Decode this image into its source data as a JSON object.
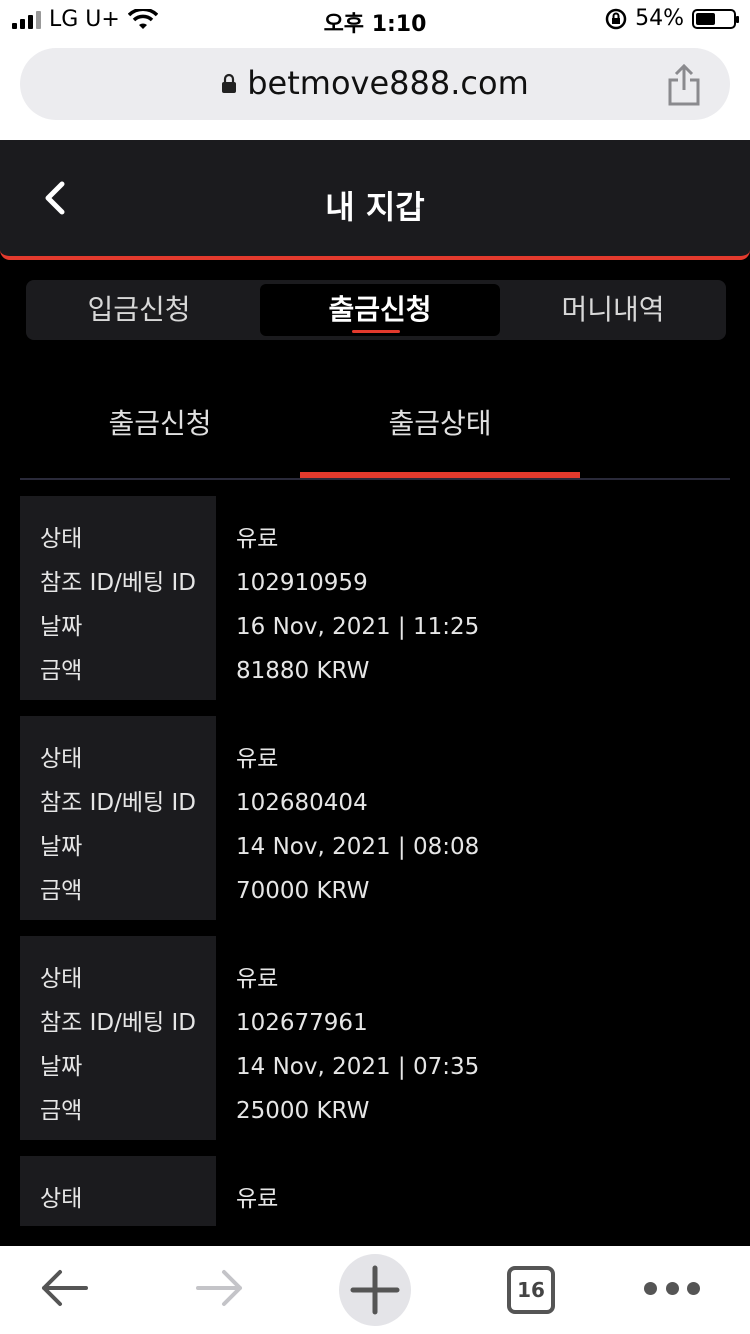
{
  "status_bar": {
    "carrier": "LG U+",
    "time": "오후 1:10",
    "battery": "54%",
    "battery_level": 0.54
  },
  "browser": {
    "url": "betmove888.com",
    "tabs_count": "16"
  },
  "header": {
    "title": "내 지갑"
  },
  "main_tabs": [
    {
      "label": "입금신청"
    },
    {
      "label": "출금신청"
    },
    {
      "label": "머니내역"
    }
  ],
  "sub_tabs": [
    {
      "label": "출금신청"
    },
    {
      "label": "출금상태"
    }
  ],
  "field_labels": {
    "status": "상태",
    "ref_id": "참조 ID/베팅 ID",
    "date": "날짜",
    "amount": "금액"
  },
  "records": [
    {
      "status": "유료",
      "ref_id": "102910959",
      "date": "16 Nov, 2021 | 11:25",
      "amount": "81880 KRW"
    },
    {
      "status": "유료",
      "ref_id": "102680404",
      "date": "14 Nov, 2021 | 08:08",
      "amount": "70000 KRW"
    },
    {
      "status": "유료",
      "ref_id": "102677961",
      "date": "14 Nov, 2021 | 07:35",
      "amount": "25000 KRW"
    },
    {
      "status": "유료"
    }
  ],
  "colors": {
    "accent": "#e33a2d",
    "panel": "#1b1b1e",
    "background": "#000000"
  }
}
